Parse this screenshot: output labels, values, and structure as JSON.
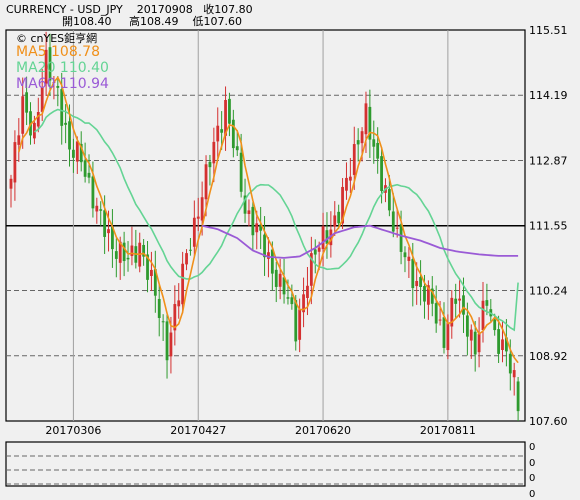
{
  "header": {
    "line1": "CURRENCY - USD_JPY    20170908   收107.80",
    "line2": "開108.40     高108.49    低107.60"
  },
  "brand": "© cnYES鉅亨網",
  "legend": {
    "ma5": "MA5 108.78",
    "ma20": "MA20 110.40",
    "ma60": "MA60 110.94"
  },
  "colors": {
    "up": "#d43030",
    "down": "#2e9a2e",
    "ma5": "#f0901a",
    "ma20": "#64d494",
    "ma60": "#9a5ad6",
    "grid": "#666666",
    "bg": "#f0f0f0"
  },
  "chart_data": {
    "type": "candlestick",
    "title": "CURRENCY - USD_JPY",
    "last_bar": {
      "date": "20170908",
      "open": 108.4,
      "high": 108.49,
      "low": 107.6,
      "close": 107.8
    },
    "y_ticks": [
      115.51,
      114.19,
      112.87,
      111.55,
      110.24,
      108.92,
      107.6
    ],
    "ylim": [
      107.6,
      115.51
    ],
    "x_ticks": [
      "20170306",
      "20170427",
      "20170620",
      "20170811"
    ],
    "x_tick_index": [
      16,
      48,
      80,
      112
    ],
    "grid": true,
    "series": [
      {
        "name": "MA5",
        "last": 108.78
      },
      {
        "name": "MA20",
        "last": 110.4
      },
      {
        "name": "MA60",
        "last": 110.94
      }
    ],
    "price_anchors": [
      [
        0,
        112.5
      ],
      [
        3,
        114.0
      ],
      [
        6,
        113.5
      ],
      [
        9,
        114.8
      ],
      [
        12,
        114.3
      ],
      [
        15,
        113.0
      ],
      [
        18,
        113.0
      ],
      [
        22,
        111.8
      ],
      [
        26,
        111.2
      ],
      [
        30,
        110.8
      ],
      [
        33,
        111.2
      ],
      [
        37,
        110.1
      ],
      [
        40,
        109.1
      ],
      [
        42,
        109.8
      ],
      [
        46,
        111.3
      ],
      [
        50,
        112.5
      ],
      [
        53,
        113.5
      ],
      [
        55,
        114.0
      ],
      [
        57,
        113.2
      ],
      [
        60,
        111.9
      ],
      [
        63,
        111.5
      ],
      [
        66,
        110.8
      ],
      [
        70,
        110.3
      ],
      [
        73,
        109.4
      ],
      [
        76,
        110.6
      ],
      [
        80,
        111.3
      ],
      [
        84,
        111.8
      ],
      [
        87,
        112.7
      ],
      [
        89,
        113.4
      ],
      [
        91,
        113.8
      ],
      [
        93,
        113.0
      ],
      [
        96,
        112.3
      ],
      [
        99,
        111.2
      ],
      [
        102,
        110.8
      ],
      [
        105,
        110.2
      ],
      [
        108,
        110.0
      ],
      [
        111,
        109.3
      ],
      [
        114,
        110.1
      ],
      [
        117,
        109.6
      ],
      [
        119,
        109.0
      ],
      [
        122,
        110.1
      ],
      [
        124,
        109.4
      ],
      [
        127,
        108.9
      ],
      [
        129,
        108.4
      ],
      [
        130,
        107.8
      ]
    ],
    "ma60_anchors": [
      [
        49,
        111.55
      ],
      [
        53,
        111.48
      ],
      [
        58,
        111.3
      ],
      [
        62,
        111.05
      ],
      [
        66,
        110.92
      ],
      [
        70,
        110.9
      ],
      [
        74,
        110.93
      ],
      [
        78,
        111.1
      ],
      [
        83,
        111.4
      ],
      [
        88,
        111.52
      ],
      [
        92,
        111.55
      ],
      [
        96,
        111.45
      ],
      [
        100,
        111.35
      ],
      [
        105,
        111.25
      ],
      [
        110,
        111.1
      ],
      [
        115,
        111.02
      ],
      [
        120,
        110.97
      ],
      [
        125,
        110.94
      ],
      [
        129,
        110.94
      ]
    ],
    "volume_panel": {
      "ticks": [
        "0",
        "0",
        "0",
        "0"
      ]
    }
  }
}
